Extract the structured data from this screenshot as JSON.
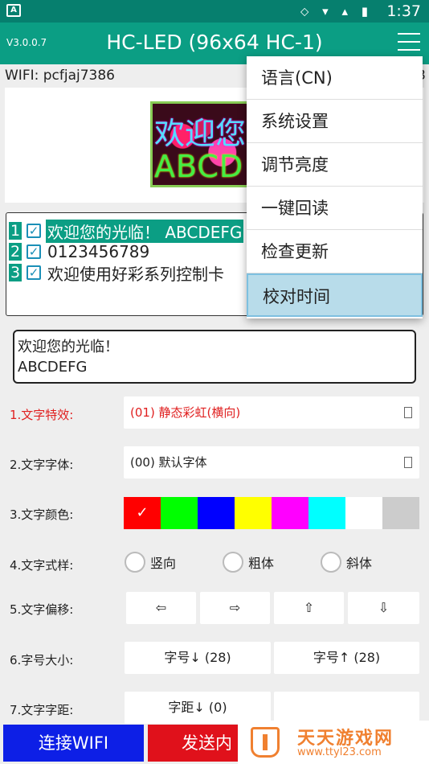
{
  "status_bar": {
    "app_icon": "A",
    "icons": "⬦ ▾ ▴ ▮",
    "time": "1:37"
  },
  "app_bar": {
    "version": "V3.0.0.7",
    "title": "HC-LED (96x64 HC-1)"
  },
  "wifi": {
    "label": "WIFI: pcfjaj7386",
    "right": "3"
  },
  "led_preview": {
    "line1": "欢迎您",
    "line2": "ABCD"
  },
  "program_list": [
    {
      "num": "1",
      "text": "欢迎您的光临！ ABCDEFG"
    },
    {
      "num": "2",
      "text": "0123456789"
    },
    {
      "num": "3",
      "text": "欢迎使用好彩系列控制卡"
    }
  ],
  "text_content": {
    "line1": "欢迎您的光临！",
    "line2": "ABCDEFG"
  },
  "settings": {
    "effect": {
      "label": "1.文字特效:",
      "value": "(01) 静态彩虹(横向)"
    },
    "font": {
      "label": "2.文字字体:",
      "value": "(00) 默认字体"
    },
    "color": {
      "label": "3.文字颜色:",
      "selected_mark": "✓",
      "swatches": [
        "#ff0000",
        "#00ff00",
        "#0000ff",
        "#ffff00",
        "#ff00ff",
        "#00ffff",
        "#ffffff",
        "#cccccc"
      ]
    },
    "style": {
      "label": "4.文字式样:",
      "options": [
        "竖向",
        "粗体",
        "斜体"
      ]
    },
    "offset": {
      "label": "5.文字偏移:",
      "left": "⇦",
      "right": "⇨",
      "up": "⇧",
      "down": "⇩"
    },
    "size": {
      "label": "6.字号大小:",
      "decrease": "字号↓ (28)",
      "increase": "字号↑ (28)"
    },
    "spacing": {
      "label": "7.文字字距:",
      "decrease": "字距↓ (0)"
    }
  },
  "bottom": {
    "connect_wifi": "连接WIFI",
    "send": "发送内"
  },
  "watermark": {
    "title": "天天游戏网",
    "url": "www.ttyl23.com"
  },
  "colors": {
    "primary": "#0b9e84",
    "status_bar": "#067f6e",
    "connect_button": "#0d1fe6",
    "send_button": "#e0111b",
    "accent_red": "#e02020"
  },
  "overflow_menu": [
    "语言(CN)",
    "系统设置",
    "调节亮度",
    "一键回读",
    "检查更新",
    "校对时间"
  ]
}
